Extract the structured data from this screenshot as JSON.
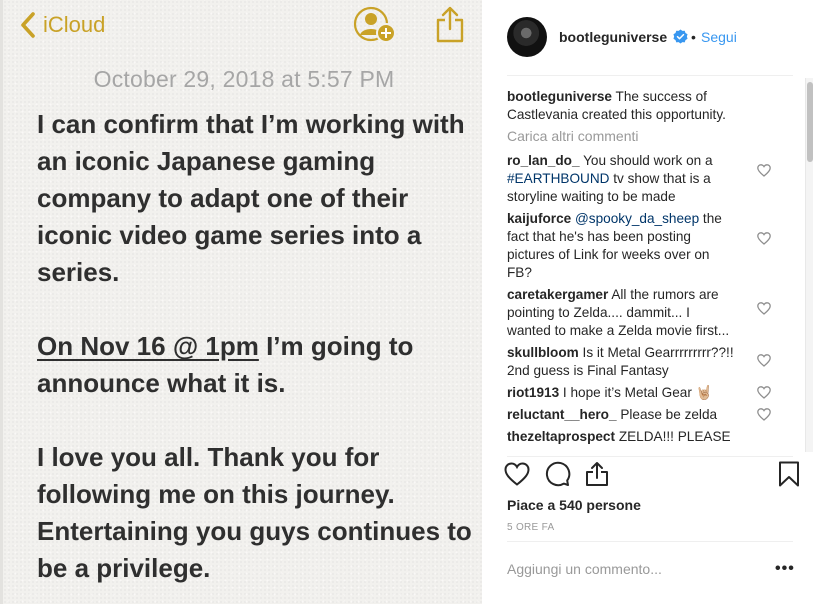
{
  "note": {
    "back_label": "iCloud",
    "date": "October 29, 2018 at 5:57 PM",
    "paragraph1": "I can confirm that I’m working with an iconic Japanese gaming company to adapt one of their iconic video game series into a series.",
    "paragraph2_underlined": "On Nov 16 @ 1pm",
    "paragraph2_rest": " I’m going to announce what it is.",
    "paragraph3": "I love you all. Thank you for following me on this journey. Entertaining you guys continues to be a privilege.",
    "accent_color": "#c9a227"
  },
  "post": {
    "username": "bootleguniverse",
    "follow_label": "Segui",
    "separator": "•",
    "caption_user": "bootleguniverse",
    "caption_text": "The success of Castlevania created this opportunity.",
    "load_more": "Carica altri commenti",
    "comments": [
      {
        "user": "ro_lan_do_",
        "pre": "You should work on a ",
        "tag": "#EARTHBOUND",
        "post": " tv show that is a storyline waiting to be made"
      },
      {
        "user": "kaijuforce",
        "pre": "",
        "tag": "@spooky_da_sheep",
        "post": " the fact that he's has been posting pictures of Link for weeks over on FB?"
      },
      {
        "user": "caretakergamer",
        "pre": "All the rumors are pointing to Zelda.... dammit... I wanted to make a Zelda movie first...",
        "tag": "",
        "post": ""
      },
      {
        "user": "skullbloom",
        "pre": "Is it Metal Gearrrrrrrrr??!! 2nd guess is Final Fantasy",
        "tag": "",
        "post": ""
      },
      {
        "user": "riot1913",
        "pre": "I hope it’s Metal Gear 🤘🏼",
        "tag": "",
        "post": ""
      },
      {
        "user": "reluctant__hero_",
        "pre": "Please be zelda",
        "tag": "",
        "post": ""
      },
      {
        "user": "thezeltaprospect",
        "pre": "ZELDA!!! PLEASE",
        "tag": "",
        "post": ""
      }
    ],
    "likes": "Piace a 540 persone",
    "time": "5 ORE FA",
    "add_comment_placeholder": "Aggiungi un commento...",
    "more_options": "•••",
    "link_color": "#3897f0"
  }
}
